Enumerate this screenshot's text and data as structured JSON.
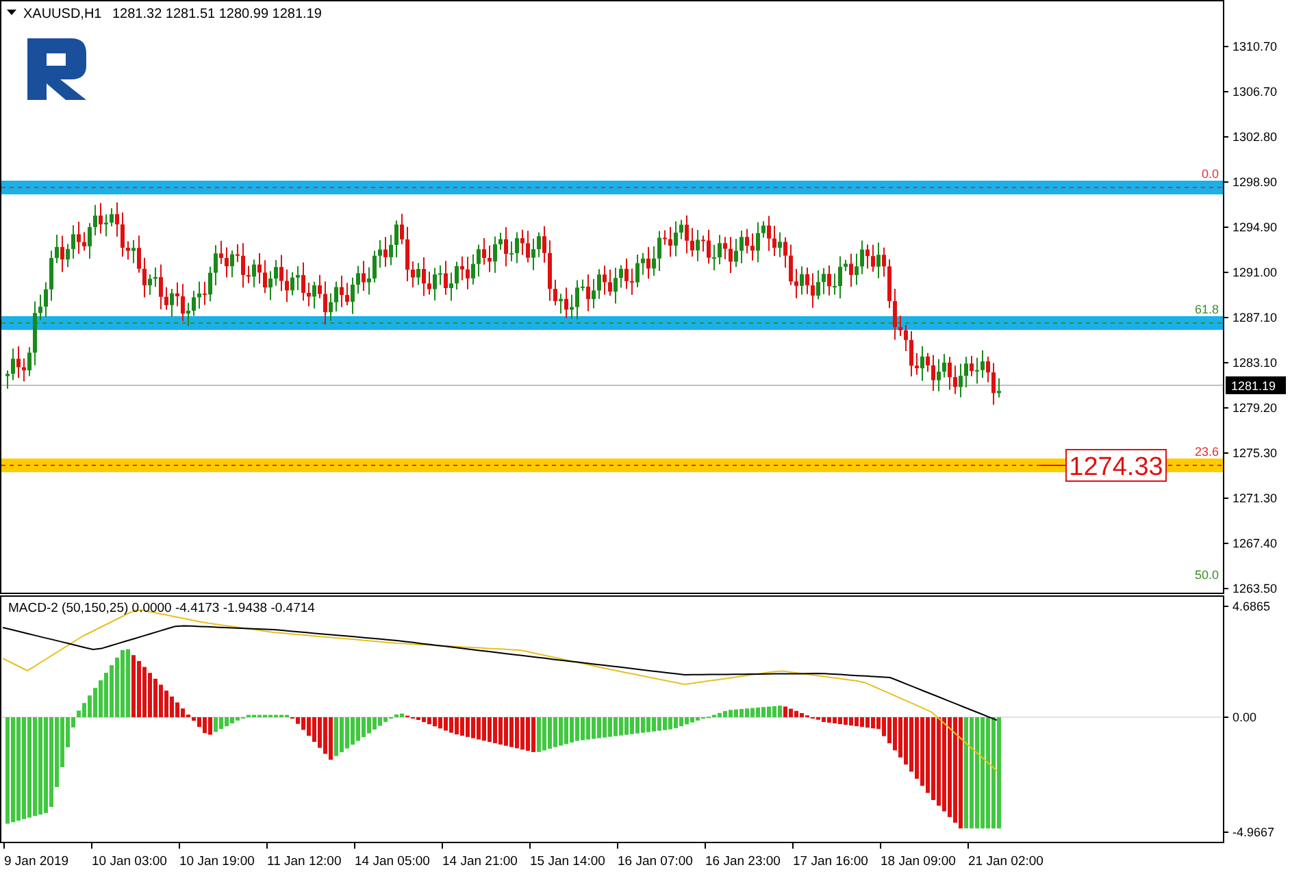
{
  "header": {
    "symbol": "XAUUSD,H1",
    "ohlc": "1281.32 1281.51 1280.99 1281.19"
  },
  "price_axis": {
    "ticks": [
      "1310.70",
      "1306.70",
      "1302.80",
      "1298.90",
      "1294.90",
      "1291.00",
      "1287.10",
      "1283.10",
      "1279.20",
      "1275.30",
      "1271.30",
      "1267.40",
      "1263.50"
    ],
    "current_price": "1281.19"
  },
  "fib_levels": [
    {
      "label": "0.0",
      "color": "#e03030",
      "kind": "blue_zone"
    },
    {
      "label": "61.8",
      "color": "#3c8c28",
      "kind": "blue_zone"
    },
    {
      "label": "23.6",
      "color": "#e03030",
      "kind": "yellow_zone"
    },
    {
      "label": "50.0",
      "color": "#3c8c28",
      "kind": "plain"
    }
  ],
  "price_tag": "1274.33",
  "macd": {
    "label": "MACD-2 (50,150,25) 0.0000 -4.4173 -1.9438 -0.4714",
    "ticks": [
      "4.6865",
      "0.00",
      "-4.9667"
    ]
  },
  "time_axis": [
    "9 Jan 2019",
    "10 Jan 03:00",
    "10 Jan 19:00",
    "11 Jan 12:00",
    "14 Jan 05:00",
    "14 Jan 21:00",
    "15 Jan 14:00",
    "16 Jan 07:00",
    "16 Jan 23:00",
    "17 Jan 16:00",
    "18 Jan 09:00",
    "21 Jan 02:00"
  ]
}
